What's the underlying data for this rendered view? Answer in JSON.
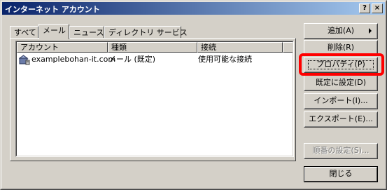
{
  "window": {
    "title": "インターネット アカウント",
    "help_label": "?",
    "close_label": "×"
  },
  "tabs": [
    {
      "label": "すべて",
      "active": false
    },
    {
      "label": "メール",
      "active": true
    },
    {
      "label": "ニュース",
      "active": false
    },
    {
      "label": "ディレクトリ サービス",
      "active": false
    }
  ],
  "list": {
    "columns": [
      "アカウント",
      "種類",
      "接続"
    ],
    "rows": [
      {
        "account": "examplebohan-it.com",
        "type": "メール (既定)",
        "connection": "使用可能な接続",
        "icon": "mail-account-icon"
      }
    ]
  },
  "buttons": {
    "add": "追加(A)",
    "remove": "削除(R)",
    "properties": "プロパティ(P)",
    "set_default": "既定に設定(D)",
    "import": "インポート(I)...",
    "export": "エクスポート(E)...",
    "set_order": "順番の設定(S)...",
    "close": "閉じる"
  },
  "highlight_color": "#ff0000"
}
